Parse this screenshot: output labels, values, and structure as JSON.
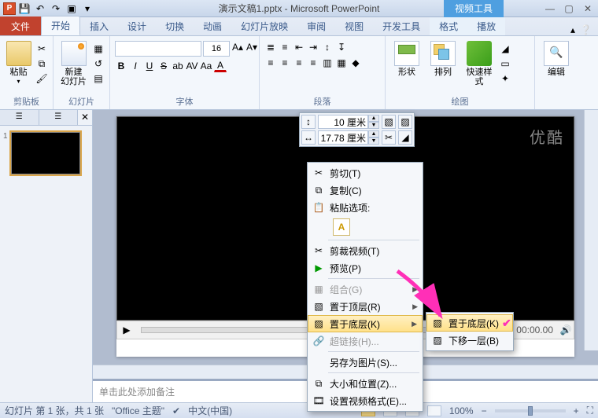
{
  "title": "演示文稿1.pptx - Microsoft PowerPoint",
  "context_tool_title": "视频工具",
  "qat": {
    "save": "💾",
    "undo": "↶",
    "redo": "↷",
    "slideshow": "▣"
  },
  "tabs": {
    "file": "文件",
    "items": [
      "开始",
      "插入",
      "设计",
      "切换",
      "动画",
      "幻灯片放映",
      "审阅",
      "视图",
      "开发工具"
    ],
    "context": [
      "格式",
      "播放"
    ],
    "active": 0
  },
  "ribbon": {
    "clipboard": {
      "paste": "粘贴",
      "label": "剪贴板"
    },
    "slides": {
      "newslide": "新建\n幻灯片",
      "label": "幻灯片"
    },
    "font": {
      "family": "",
      "size": "16",
      "label": "字体"
    },
    "paragraph": {
      "label": "段落"
    },
    "drawing": {
      "shapes": "形状",
      "arrange": "排列",
      "quickstyle": "快速样式",
      "label": "绘图"
    },
    "editing": {
      "edit": "编辑",
      "label": ""
    }
  },
  "thumb": {
    "tab1_icon": "☰",
    "slide_num": "1"
  },
  "watermark": "优酷",
  "video": {
    "play": "▶",
    "time": "00:00.00",
    "vol": "🔊"
  },
  "notes_placeholder": "单击此处添加备注",
  "mini_toolbar": {
    "height_icon": "↕",
    "height_val": "10 厘米",
    "width_icon": "↔",
    "width_val": "17.78 厘米",
    "crop": "✂"
  },
  "ctx": {
    "cut": "剪切(T)",
    "copy": "复制(C)",
    "paste_label": "粘贴选项:",
    "trim": "剪裁视频(T)",
    "preview": "预览(P)",
    "group": "组合(G)",
    "bring_front": "置于顶层(R)",
    "send_back": "置于底层(K)",
    "hyperlink": "超链接(H)...",
    "save_pic": "另存为图片(S)...",
    "size_pos": "大小和位置(Z)...",
    "format_vid": "设置视频格式(E)..."
  },
  "sub": {
    "send_back": "置于底层(K)",
    "back_one": "下移一层(B)"
  },
  "status": {
    "slide_info": "幻灯片 第 1 张，共 1 张",
    "theme": "\"Office 主题\"",
    "lang": "中文(中国)",
    "zoom": "100%"
  }
}
